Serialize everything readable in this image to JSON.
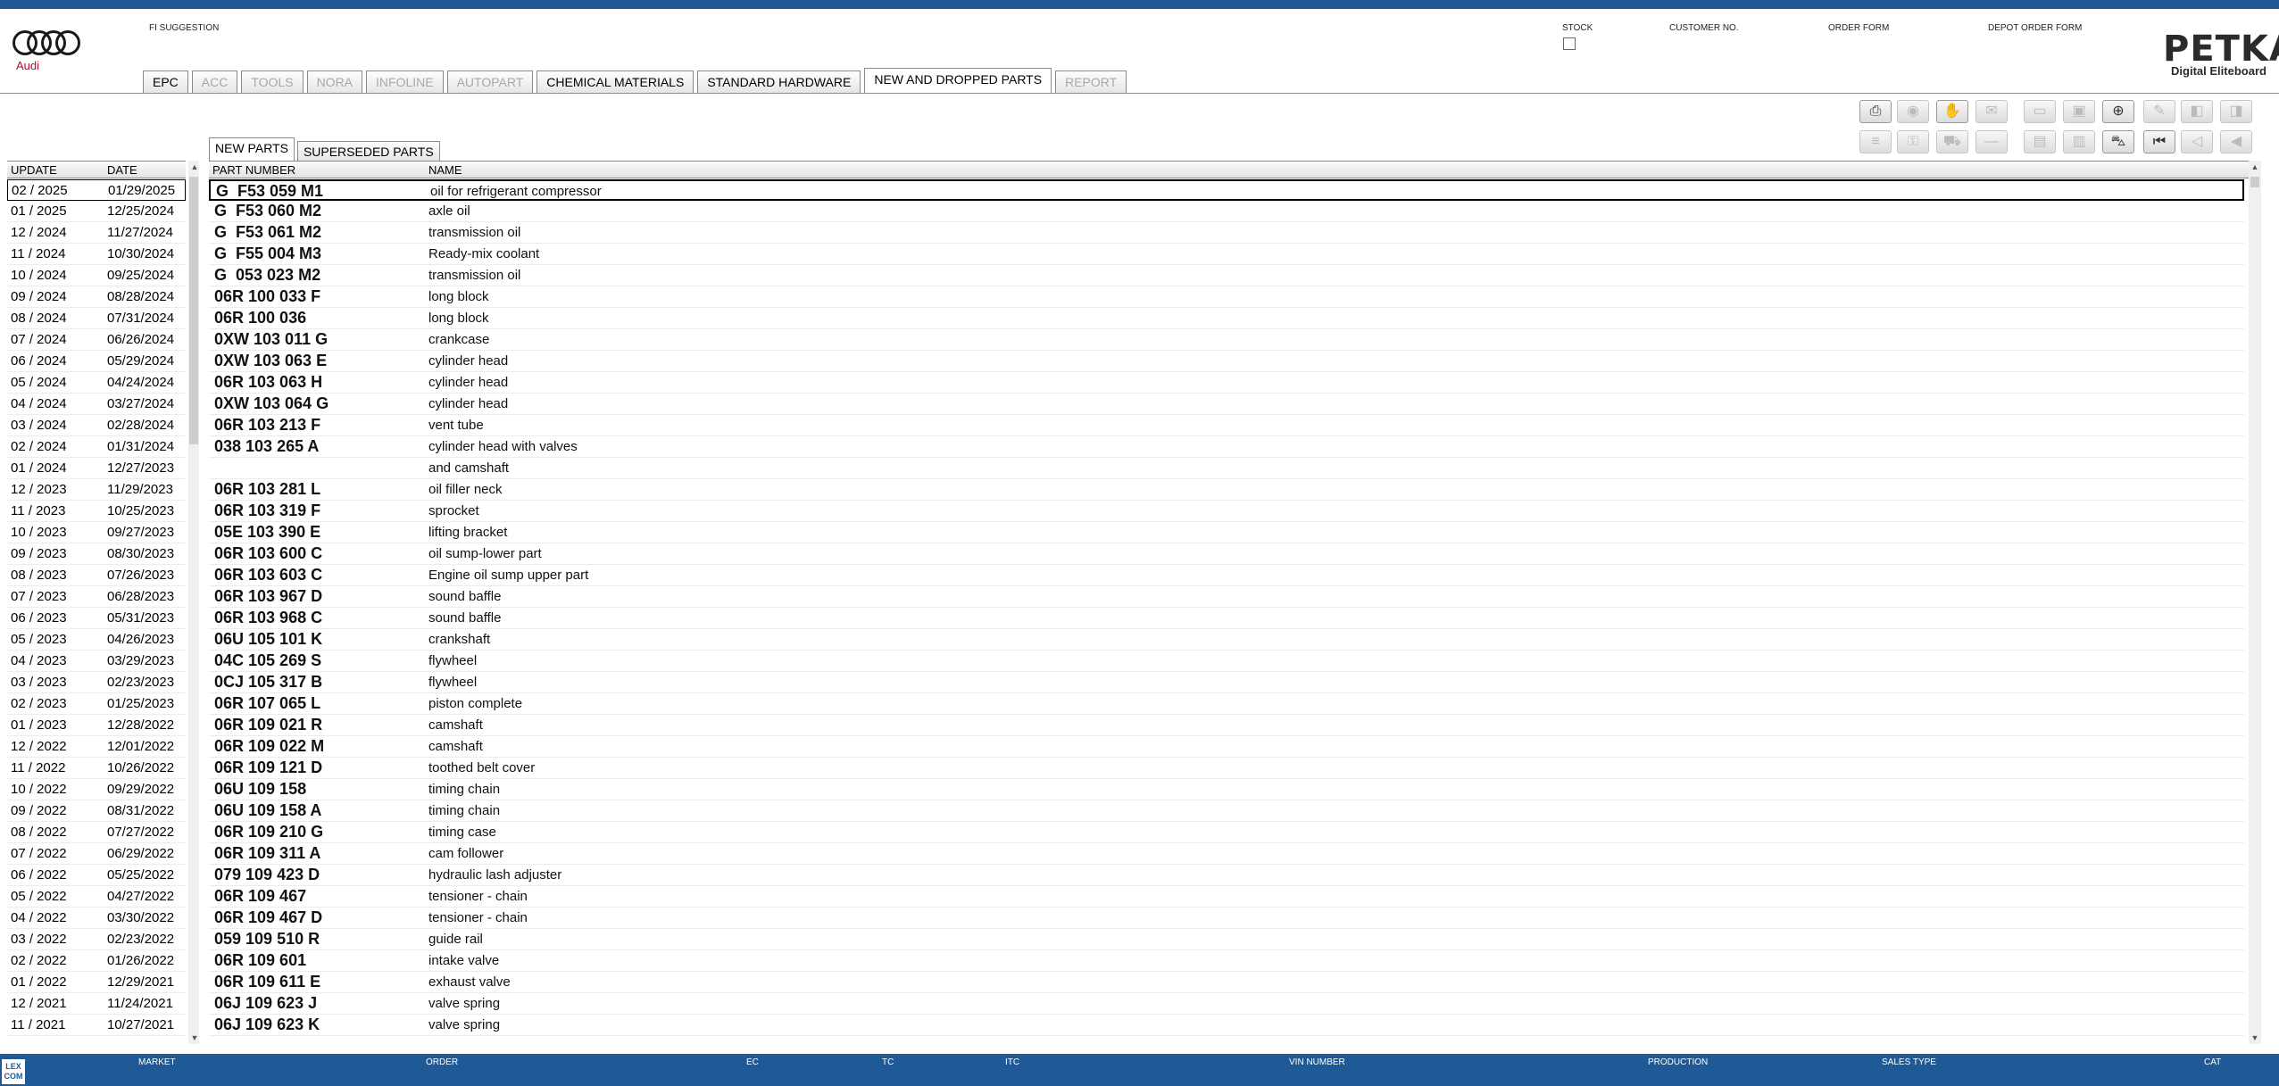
{
  "brand": {
    "name": "Audi"
  },
  "header": {
    "fi_suggestion": "FI SUGGESTION",
    "stock": "STOCK",
    "customer_no": "CUSTOMER NO.",
    "order_form": "ORDER FORM",
    "depot_order_form": "DEPOT ORDER FORM"
  },
  "logo": {
    "title": "PETKA",
    "subtitle": "Digital Eliteboard"
  },
  "tabs": [
    {
      "label": "EPC",
      "state": "enabled"
    },
    {
      "label": "ACC",
      "state": "disabled"
    },
    {
      "label": "TOOLS",
      "state": "disabled"
    },
    {
      "label": "NORA",
      "state": "disabled"
    },
    {
      "label": "INFOLINE",
      "state": "disabled"
    },
    {
      "label": "AUTOPART",
      "state": "disabled"
    },
    {
      "label": "CHEMICAL MATERIALS",
      "state": "enabled"
    },
    {
      "label": "STANDARD HARDWARE",
      "state": "enabled"
    },
    {
      "label": "NEW AND DROPPED PARTS",
      "state": "active"
    },
    {
      "label": "REPORT",
      "state": "disabled"
    }
  ],
  "toolbar": {
    "row1": [
      "printer-icon",
      "disc-icon",
      "hands-icon",
      "chat-icon",
      "display-icon",
      "monitor-icon",
      "cart-add-icon",
      "pin-icon",
      "page-back-icon",
      "page-forward-icon"
    ],
    "row2": [
      "list-icon",
      "key-icon",
      "car-icon",
      "line-icon",
      "box-icon",
      "cart-list-icon",
      "cart-icon",
      "first-icon",
      "previous-icon",
      "back-icon"
    ]
  },
  "update_list": {
    "headers": {
      "update": "UPDATE",
      "date": "DATE"
    },
    "rows": [
      {
        "update": "02 / 2025",
        "date": "01/29/2025"
      },
      {
        "update": "01 / 2025",
        "date": "12/25/2024"
      },
      {
        "update": "12 / 2024",
        "date": "11/27/2024"
      },
      {
        "update": "11 / 2024",
        "date": "10/30/2024"
      },
      {
        "update": "10 / 2024",
        "date": "09/25/2024"
      },
      {
        "update": "09 / 2024",
        "date": "08/28/2024"
      },
      {
        "update": "08 / 2024",
        "date": "07/31/2024"
      },
      {
        "update": "07 / 2024",
        "date": "06/26/2024"
      },
      {
        "update": "06 / 2024",
        "date": "05/29/2024"
      },
      {
        "update": "05 / 2024",
        "date": "04/24/2024"
      },
      {
        "update": "04 / 2024",
        "date": "03/27/2024"
      },
      {
        "update": "03 / 2024",
        "date": "02/28/2024"
      },
      {
        "update": "02 / 2024",
        "date": "01/31/2024"
      },
      {
        "update": "01 / 2024",
        "date": "12/27/2023"
      },
      {
        "update": "12 / 2023",
        "date": "11/29/2023"
      },
      {
        "update": "11 / 2023",
        "date": "10/25/2023"
      },
      {
        "update": "10 / 2023",
        "date": "09/27/2023"
      },
      {
        "update": "09 / 2023",
        "date": "08/30/2023"
      },
      {
        "update": "08 / 2023",
        "date": "07/26/2023"
      },
      {
        "update": "07 / 2023",
        "date": "06/28/2023"
      },
      {
        "update": "06 / 2023",
        "date": "05/31/2023"
      },
      {
        "update": "05 / 2023",
        "date": "04/26/2023"
      },
      {
        "update": "04 / 2023",
        "date": "03/29/2023"
      },
      {
        "update": "03 / 2023",
        "date": "02/23/2023"
      },
      {
        "update": "02 / 2023",
        "date": "01/25/2023"
      },
      {
        "update": "01 / 2023",
        "date": "12/28/2022"
      },
      {
        "update": "12 / 2022",
        "date": "12/01/2022"
      },
      {
        "update": "11 / 2022",
        "date": "10/26/2022"
      },
      {
        "update": "10 / 2022",
        "date": "09/29/2022"
      },
      {
        "update": "09 / 2022",
        "date": "08/31/2022"
      },
      {
        "update": "08 / 2022",
        "date": "07/27/2022"
      },
      {
        "update": "07 / 2022",
        "date": "06/29/2022"
      },
      {
        "update": "06 / 2022",
        "date": "05/25/2022"
      },
      {
        "update": "05 / 2022",
        "date": "04/27/2022"
      },
      {
        "update": "04 / 2022",
        "date": "03/30/2022"
      },
      {
        "update": "03 / 2022",
        "date": "02/23/2022"
      },
      {
        "update": "02 / 2022",
        "date": "01/26/2022"
      },
      {
        "update": "01 / 2022",
        "date": "12/29/2021"
      },
      {
        "update": "12 / 2021",
        "date": "11/24/2021"
      },
      {
        "update": "11 / 2021",
        "date": "10/27/2021"
      }
    ]
  },
  "sub_tabs": [
    {
      "label": "NEW PARTS",
      "state": "active"
    },
    {
      "label": "SUPERSEDED PARTS",
      "state": "enabled"
    }
  ],
  "parts": {
    "headers": {
      "part_number": "PART NUMBER",
      "name": "NAME"
    },
    "rows": [
      {
        "part_number": "G  F53 059 M1",
        "name": "oil for refrigerant compressor"
      },
      {
        "part_number": "G  F53 060 M2",
        "name": "axle oil"
      },
      {
        "part_number": "G  F53 061 M2",
        "name": "transmission oil"
      },
      {
        "part_number": "G  F55 004 M3",
        "name": "Ready-mix coolant"
      },
      {
        "part_number": "G  053 023 M2",
        "name": "transmission oil"
      },
      {
        "part_number": "06R 100 033 F",
        "name": "long block"
      },
      {
        "part_number": "06R 100 036",
        "name": "long block"
      },
      {
        "part_number": "0XW 103 011 G",
        "name": "crankcase"
      },
      {
        "part_number": "0XW 103 063 E",
        "name": "cylinder head"
      },
      {
        "part_number": "06R 103 063 H",
        "name": "cylinder head"
      },
      {
        "part_number": "0XW 103 064 G",
        "name": "cylinder head"
      },
      {
        "part_number": "06R 103 213 F",
        "name": "vent tube"
      },
      {
        "part_number": "038 103 265 A",
        "name": "cylinder head with valves"
      },
      {
        "part_number": "",
        "name": "and camshaft"
      },
      {
        "part_number": "06R 103 281 L",
        "name": "oil filler neck"
      },
      {
        "part_number": "06R 103 319 F",
        "name": "sprocket"
      },
      {
        "part_number": "05E 103 390 E",
        "name": "lifting bracket"
      },
      {
        "part_number": "06R 103 600 C",
        "name": "oil sump-lower part"
      },
      {
        "part_number": "06R 103 603 C",
        "name": "Engine oil sump upper part"
      },
      {
        "part_number": "06R 103 967 D",
        "name": "sound baffle"
      },
      {
        "part_number": "06R 103 968 C",
        "name": "sound baffle"
      },
      {
        "part_number": "06U 105 101 K",
        "name": "crankshaft"
      },
      {
        "part_number": "04C 105 269 S",
        "name": "flywheel"
      },
      {
        "part_number": "0CJ 105 317 B",
        "name": "flywheel"
      },
      {
        "part_number": "06R 107 065 L",
        "name": "piston complete"
      },
      {
        "part_number": "06R 109 021 R",
        "name": "camshaft"
      },
      {
        "part_number": "06R 109 022 M",
        "name": "camshaft"
      },
      {
        "part_number": "06R 109 121 D",
        "name": "toothed belt cover"
      },
      {
        "part_number": "06U 109 158",
        "name": "timing chain"
      },
      {
        "part_number": "06U 109 158 A",
        "name": "timing chain"
      },
      {
        "part_number": "06R 109 210 G",
        "name": "timing case"
      },
      {
        "part_number": "06R 109 311 A",
        "name": "cam follower"
      },
      {
        "part_number": "079 109 423 D",
        "name": "hydraulic lash adjuster"
      },
      {
        "part_number": "06R 109 467",
        "name": "tensioner - chain"
      },
      {
        "part_number": "06R 109 467 D",
        "name": "tensioner - chain"
      },
      {
        "part_number": "059 109 510 R",
        "name": "guide rail"
      },
      {
        "part_number": "06R 109 601",
        "name": "intake valve"
      },
      {
        "part_number": "06R 109 611 E",
        "name": "exhaust valve"
      },
      {
        "part_number": "06J 109 623 J",
        "name": "valve spring"
      },
      {
        "part_number": "06J 109 623 K",
        "name": "valve spring"
      }
    ]
  },
  "status_bar": {
    "logo": "LEX COM",
    "labels": [
      "MARKET",
      "ORDER",
      "EC",
      "TC",
      "ITC",
      "VIN NUMBER",
      "PRODUCTION",
      "SALES TYPE",
      "CAT"
    ]
  }
}
